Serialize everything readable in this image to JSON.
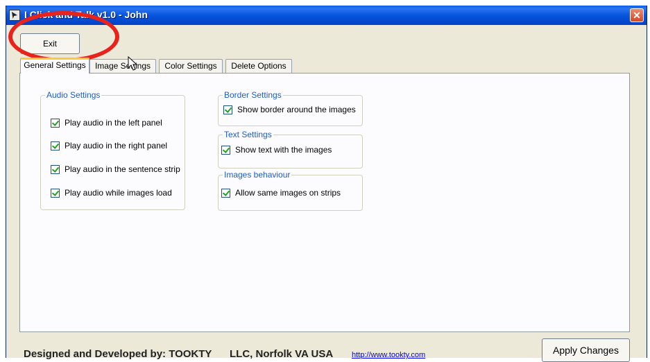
{
  "window": {
    "title": "I Click and Talk v1.0 - John",
    "close_glyph": "✕"
  },
  "toolbar": {
    "exit_label": "Exit"
  },
  "tabs": [
    {
      "label": "General Settings",
      "active": true
    },
    {
      "label": "Image Settings",
      "active": false
    },
    {
      "label": "Color Settings",
      "active": false
    },
    {
      "label": "Delete Options",
      "active": false
    }
  ],
  "audio_settings": {
    "title": "Audio Settings",
    "items": [
      {
        "label": "Play audio in the left panel",
        "checked": true
      },
      {
        "label": "Play audio in the right panel",
        "checked": true
      },
      {
        "label": "Play audio in the sentence strip",
        "checked": true
      },
      {
        "label": "Play audio while images load",
        "checked": true
      }
    ]
  },
  "border_settings": {
    "title": "Border Settings",
    "items": [
      {
        "label": "Show  border around the images",
        "checked": true
      }
    ]
  },
  "text_settings": {
    "title": "Text Settings",
    "items": [
      {
        "label": "Show  text with  the images",
        "checked": true
      }
    ]
  },
  "images_behaviour": {
    "title": "Images behaviour",
    "items": [
      {
        "label": "Allow same images on strips",
        "checked": true
      }
    ]
  },
  "footer": {
    "credit": "Designed and Developed by: TOOKTY",
    "company": "LLC,  Norfolk VA USA",
    "link": "http://www.tookty.com",
    "apply_label": "Apply Changes"
  },
  "colors": {
    "titlebar": "#0855dd",
    "annotation_circle": "#e8231b",
    "active_tab_accent": "#ffc83c",
    "group_title": "#1e5cc4"
  }
}
